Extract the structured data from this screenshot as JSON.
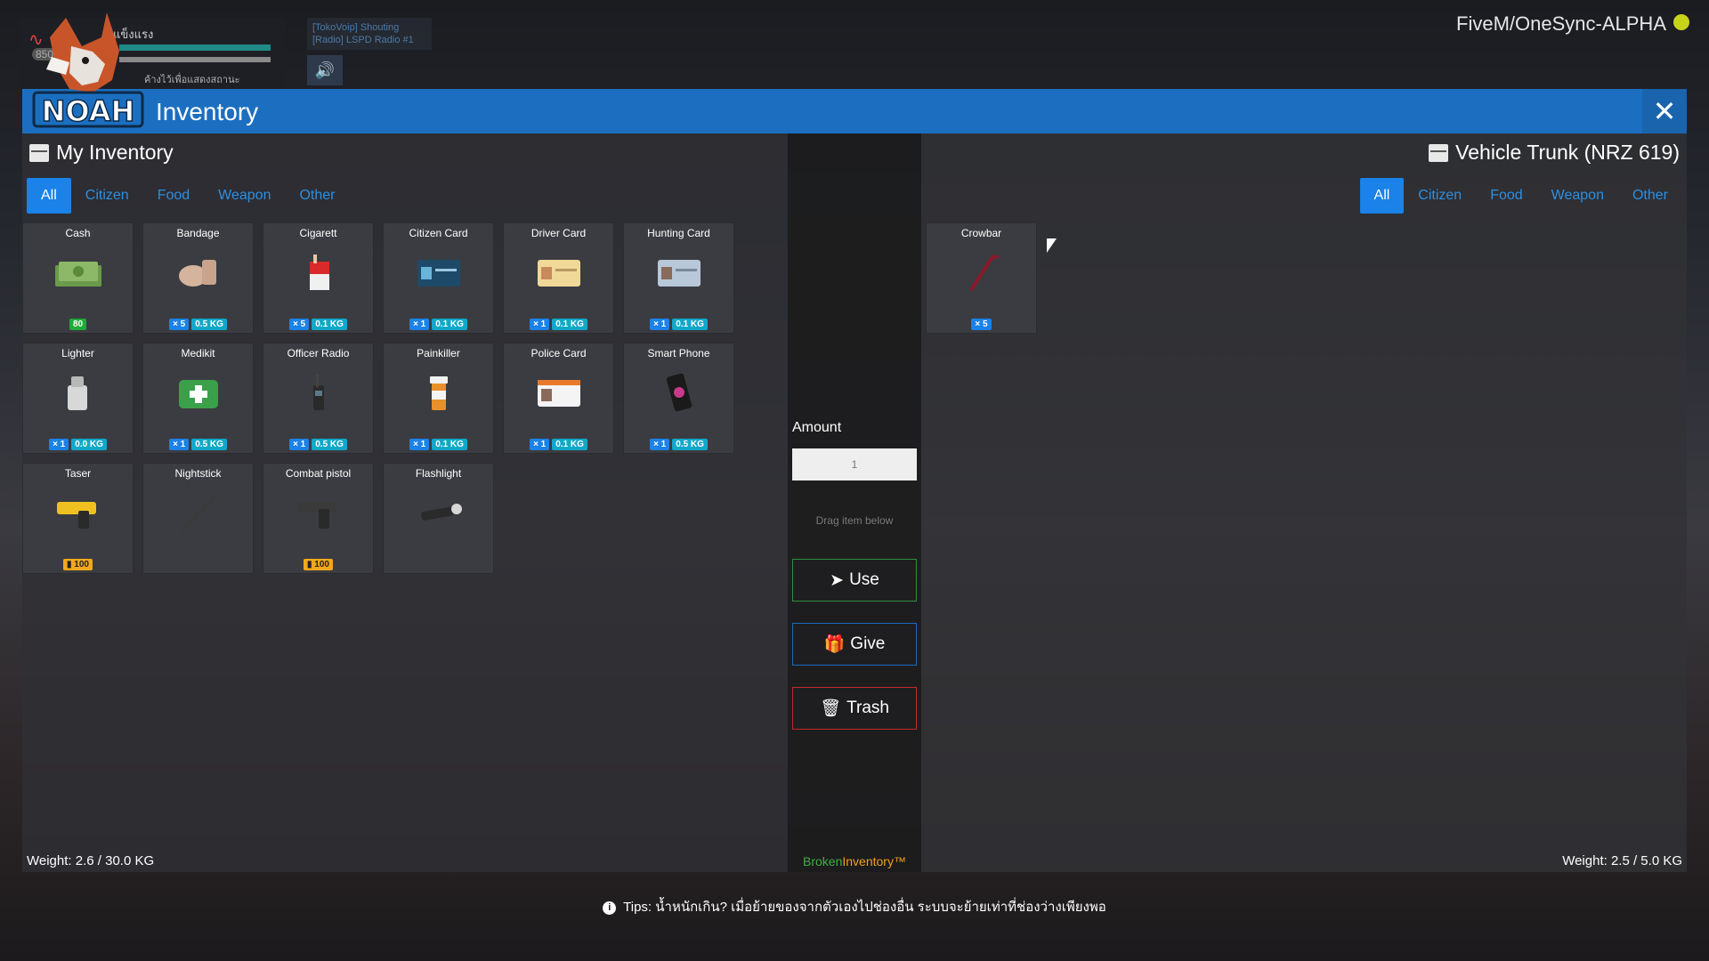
{
  "hud": {
    "status_text": "แข็งแรง",
    "sub_text": "ค้างไว้เพื่อแสดงสถานะ",
    "health_number": "850"
  },
  "voip": {
    "line1": "[TokoVoip] Shouting",
    "line2": "[Radio] LSPD Radio #1"
  },
  "server_name": "FiveM/OneSync-ALPHA",
  "logo_text": "NOAH",
  "window": {
    "title": "Inventory",
    "close_symbol": "✕"
  },
  "left": {
    "header": "My Inventory",
    "tabs": [
      "All",
      "Citizen",
      "Food",
      "Weapon",
      "Other"
    ],
    "active_tab": "All",
    "weight": "Weight: 2.6 / 30.0 KG",
    "items": [
      {
        "name": "Cash",
        "icon": "cash-icon",
        "badges": [
          {
            "type": "cash",
            "text": "80"
          }
        ]
      },
      {
        "name": "Bandage",
        "icon": "bandage-icon",
        "badges": [
          {
            "type": "count",
            "text": "× 5"
          },
          {
            "type": "weight",
            "text": "0.5 KG"
          }
        ]
      },
      {
        "name": "Cigarett",
        "icon": "cigarette-icon",
        "badges": [
          {
            "type": "count",
            "text": "× 5"
          },
          {
            "type": "weight",
            "text": "0.1 KG"
          }
        ]
      },
      {
        "name": "Citizen Card",
        "icon": "citizen-card-icon",
        "badges": [
          {
            "type": "count",
            "text": "× 1"
          },
          {
            "type": "weight",
            "text": "0.1 KG"
          }
        ]
      },
      {
        "name": "Driver Card",
        "icon": "driver-card-icon",
        "badges": [
          {
            "type": "count",
            "text": "× 1"
          },
          {
            "type": "weight",
            "text": "0.1 KG"
          }
        ]
      },
      {
        "name": "Hunting Card",
        "icon": "hunting-card-icon",
        "badges": [
          {
            "type": "count",
            "text": "× 1"
          },
          {
            "type": "weight",
            "text": "0.1 KG"
          }
        ]
      },
      {
        "name": "Lighter",
        "icon": "lighter-icon",
        "badges": [
          {
            "type": "count",
            "text": "× 1"
          },
          {
            "type": "weight",
            "text": "0.0 KG"
          }
        ]
      },
      {
        "name": "Medikit",
        "icon": "medikit-icon",
        "badges": [
          {
            "type": "count",
            "text": "× 1"
          },
          {
            "type": "weight",
            "text": "0.5 KG"
          }
        ]
      },
      {
        "name": "Officer Radio",
        "icon": "radio-icon",
        "badges": [
          {
            "type": "count",
            "text": "× 1"
          },
          {
            "type": "weight",
            "text": "0.5 KG"
          }
        ]
      },
      {
        "name": "Painkiller",
        "icon": "painkiller-icon",
        "badges": [
          {
            "type": "count",
            "text": "× 1"
          },
          {
            "type": "weight",
            "text": "0.1 KG"
          }
        ]
      },
      {
        "name": "Police Card",
        "icon": "police-card-icon",
        "badges": [
          {
            "type": "count",
            "text": "× 1"
          },
          {
            "type": "weight",
            "text": "0.1 KG"
          }
        ]
      },
      {
        "name": "Smart Phone",
        "icon": "phone-icon",
        "badges": [
          {
            "type": "count",
            "text": "× 1"
          },
          {
            "type": "weight",
            "text": "0.5 KG"
          }
        ]
      },
      {
        "name": "Taser",
        "icon": "taser-icon",
        "badges": [
          {
            "type": "ammo",
            "text": "▮ 100"
          }
        ]
      },
      {
        "name": "Nightstick",
        "icon": "nightstick-icon",
        "badges": []
      },
      {
        "name": "Combat pistol",
        "icon": "pistol-icon",
        "badges": [
          {
            "type": "ammo",
            "text": "▮ 100"
          }
        ]
      },
      {
        "name": "Flashlight",
        "icon": "flashlight-icon",
        "badges": []
      }
    ]
  },
  "middle": {
    "amount_label": "Amount",
    "amount_value": "1",
    "drag_hint": "Drag item below",
    "use_label": "Use",
    "give_label": "Give",
    "trash_label": "Trash",
    "brand_part1": "Broken",
    "brand_part2": "Inventory™"
  },
  "right": {
    "header": "Vehicle Trunk (NRZ 619)",
    "tabs": [
      "All",
      "Citizen",
      "Food",
      "Weapon",
      "Other"
    ],
    "active_tab": "All",
    "weight": "Weight: 2.5 / 5.0 KG",
    "items": [
      {
        "name": "Crowbar",
        "icon": "crowbar-icon",
        "badges": [
          {
            "type": "count",
            "text": "× 5"
          }
        ]
      }
    ]
  },
  "tips": "Tips: น้ำหนักเกิน? เมื่อย้ายของจากตัวเองไปช่องอื่น ระบบจะย้ายเท่าที่ช่องว่างเพียงพอ"
}
